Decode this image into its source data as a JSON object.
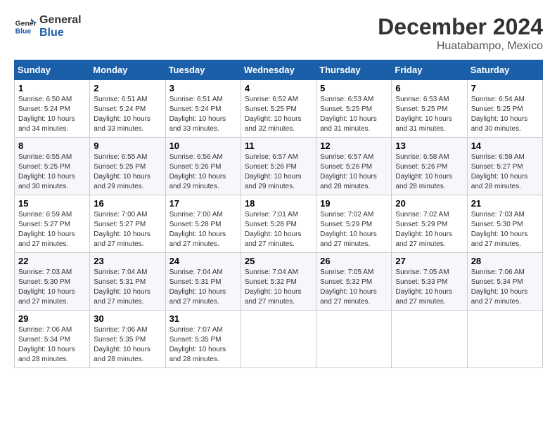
{
  "header": {
    "logo_line1": "General",
    "logo_line2": "Blue",
    "title": "December 2024",
    "subtitle": "Huatabampo, Mexico"
  },
  "calendar": {
    "days_of_week": [
      "Sunday",
      "Monday",
      "Tuesday",
      "Wednesday",
      "Thursday",
      "Friday",
      "Saturday"
    ],
    "weeks": [
      [
        {
          "day": "1",
          "info": "Sunrise: 6:50 AM\nSunset: 5:24 PM\nDaylight: 10 hours\nand 34 minutes."
        },
        {
          "day": "2",
          "info": "Sunrise: 6:51 AM\nSunset: 5:24 PM\nDaylight: 10 hours\nand 33 minutes."
        },
        {
          "day": "3",
          "info": "Sunrise: 6:51 AM\nSunset: 5:24 PM\nDaylight: 10 hours\nand 33 minutes."
        },
        {
          "day": "4",
          "info": "Sunrise: 6:52 AM\nSunset: 5:25 PM\nDaylight: 10 hours\nand 32 minutes."
        },
        {
          "day": "5",
          "info": "Sunrise: 6:53 AM\nSunset: 5:25 PM\nDaylight: 10 hours\nand 31 minutes."
        },
        {
          "day": "6",
          "info": "Sunrise: 6:53 AM\nSunset: 5:25 PM\nDaylight: 10 hours\nand 31 minutes."
        },
        {
          "day": "7",
          "info": "Sunrise: 6:54 AM\nSunset: 5:25 PM\nDaylight: 10 hours\nand 30 minutes."
        }
      ],
      [
        {
          "day": "8",
          "info": "Sunrise: 6:55 AM\nSunset: 5:25 PM\nDaylight: 10 hours\nand 30 minutes."
        },
        {
          "day": "9",
          "info": "Sunrise: 6:55 AM\nSunset: 5:25 PM\nDaylight: 10 hours\nand 29 minutes."
        },
        {
          "day": "10",
          "info": "Sunrise: 6:56 AM\nSunset: 5:26 PM\nDaylight: 10 hours\nand 29 minutes."
        },
        {
          "day": "11",
          "info": "Sunrise: 6:57 AM\nSunset: 5:26 PM\nDaylight: 10 hours\nand 29 minutes."
        },
        {
          "day": "12",
          "info": "Sunrise: 6:57 AM\nSunset: 5:26 PM\nDaylight: 10 hours\nand 28 minutes."
        },
        {
          "day": "13",
          "info": "Sunrise: 6:58 AM\nSunset: 5:26 PM\nDaylight: 10 hours\nand 28 minutes."
        },
        {
          "day": "14",
          "info": "Sunrise: 6:59 AM\nSunset: 5:27 PM\nDaylight: 10 hours\nand 28 minutes."
        }
      ],
      [
        {
          "day": "15",
          "info": "Sunrise: 6:59 AM\nSunset: 5:27 PM\nDaylight: 10 hours\nand 27 minutes."
        },
        {
          "day": "16",
          "info": "Sunrise: 7:00 AM\nSunset: 5:27 PM\nDaylight: 10 hours\nand 27 minutes."
        },
        {
          "day": "17",
          "info": "Sunrise: 7:00 AM\nSunset: 5:28 PM\nDaylight: 10 hours\nand 27 minutes."
        },
        {
          "day": "18",
          "info": "Sunrise: 7:01 AM\nSunset: 5:28 PM\nDaylight: 10 hours\nand 27 minutes."
        },
        {
          "day": "19",
          "info": "Sunrise: 7:02 AM\nSunset: 5:29 PM\nDaylight: 10 hours\nand 27 minutes."
        },
        {
          "day": "20",
          "info": "Sunrise: 7:02 AM\nSunset: 5:29 PM\nDaylight: 10 hours\nand 27 minutes."
        },
        {
          "day": "21",
          "info": "Sunrise: 7:03 AM\nSunset: 5:30 PM\nDaylight: 10 hours\nand 27 minutes."
        }
      ],
      [
        {
          "day": "22",
          "info": "Sunrise: 7:03 AM\nSunset: 5:30 PM\nDaylight: 10 hours\nand 27 minutes."
        },
        {
          "day": "23",
          "info": "Sunrise: 7:04 AM\nSunset: 5:31 PM\nDaylight: 10 hours\nand 27 minutes."
        },
        {
          "day": "24",
          "info": "Sunrise: 7:04 AM\nSunset: 5:31 PM\nDaylight: 10 hours\nand 27 minutes."
        },
        {
          "day": "25",
          "info": "Sunrise: 7:04 AM\nSunset: 5:32 PM\nDaylight: 10 hours\nand 27 minutes."
        },
        {
          "day": "26",
          "info": "Sunrise: 7:05 AM\nSunset: 5:32 PM\nDaylight: 10 hours\nand 27 minutes."
        },
        {
          "day": "27",
          "info": "Sunrise: 7:05 AM\nSunset: 5:33 PM\nDaylight: 10 hours\nand 27 minutes."
        },
        {
          "day": "28",
          "info": "Sunrise: 7:06 AM\nSunset: 5:34 PM\nDaylight: 10 hours\nand 27 minutes."
        }
      ],
      [
        {
          "day": "29",
          "info": "Sunrise: 7:06 AM\nSunset: 5:34 PM\nDaylight: 10 hours\nand 28 minutes."
        },
        {
          "day": "30",
          "info": "Sunrise: 7:06 AM\nSunset: 5:35 PM\nDaylight: 10 hours\nand 28 minutes."
        },
        {
          "day": "31",
          "info": "Sunrise: 7:07 AM\nSunset: 5:35 PM\nDaylight: 10 hours\nand 28 minutes."
        },
        {
          "day": "",
          "info": ""
        },
        {
          "day": "",
          "info": ""
        },
        {
          "day": "",
          "info": ""
        },
        {
          "day": "",
          "info": ""
        }
      ]
    ]
  }
}
